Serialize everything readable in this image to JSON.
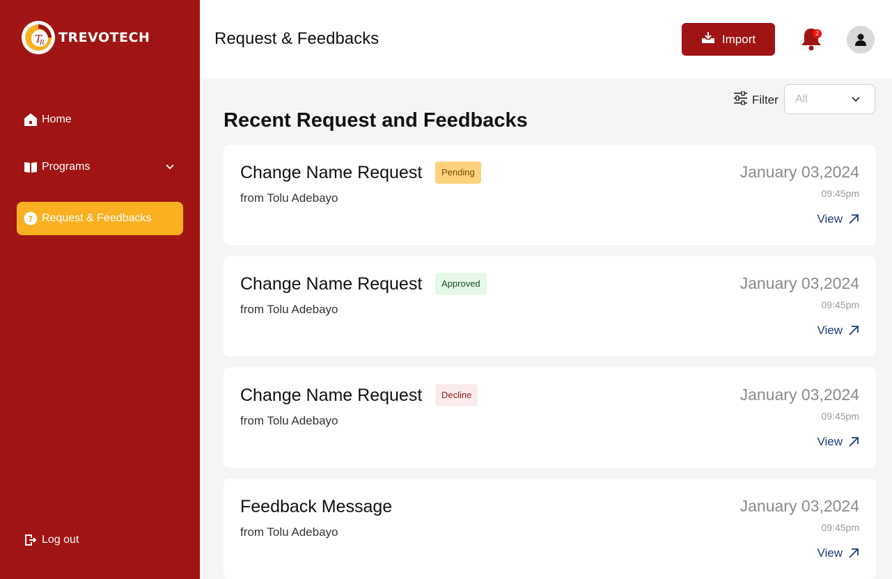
{
  "brand": {
    "name": "TREVOTECH",
    "accent": "#a01414",
    "highlight": "#fbb021"
  },
  "sidebar": {
    "items": [
      {
        "label": "Home",
        "icon": "home-icon"
      },
      {
        "label": "Programs",
        "icon": "book-icon"
      },
      {
        "label": "Request & Feedbacks",
        "icon": "help-circle-icon",
        "active": true
      }
    ],
    "logout": {
      "label": "Log out",
      "icon": "logout-icon"
    }
  },
  "header": {
    "title": "Request & Feedbacks",
    "import_label": "Import",
    "notification_count": "2"
  },
  "filter": {
    "label": "Filter",
    "selected": "All"
  },
  "main": {
    "section_title": "Recent Request and Feedbacks",
    "cards": [
      {
        "title": "Change Name Request",
        "status": "Pending",
        "from": "from Tolu Adebayo",
        "date": "January 03,2024",
        "time": "09:45pm",
        "view": "View"
      },
      {
        "title": "Change Name Request",
        "status": "Approved",
        "from": "from Tolu Adebayo",
        "date": "January 03,2024",
        "time": "09:45pm",
        "view": "View"
      },
      {
        "title": "Change Name Request",
        "status": "Decline",
        "from": "from Tolu Adebayo",
        "date": "January 03,2024",
        "time": "09:45pm",
        "view": "View"
      },
      {
        "title": "Feedback Message",
        "from": "from Tolu Adebayo",
        "date": "January 03,2024",
        "time": "09:45pm",
        "view": "View"
      }
    ]
  }
}
